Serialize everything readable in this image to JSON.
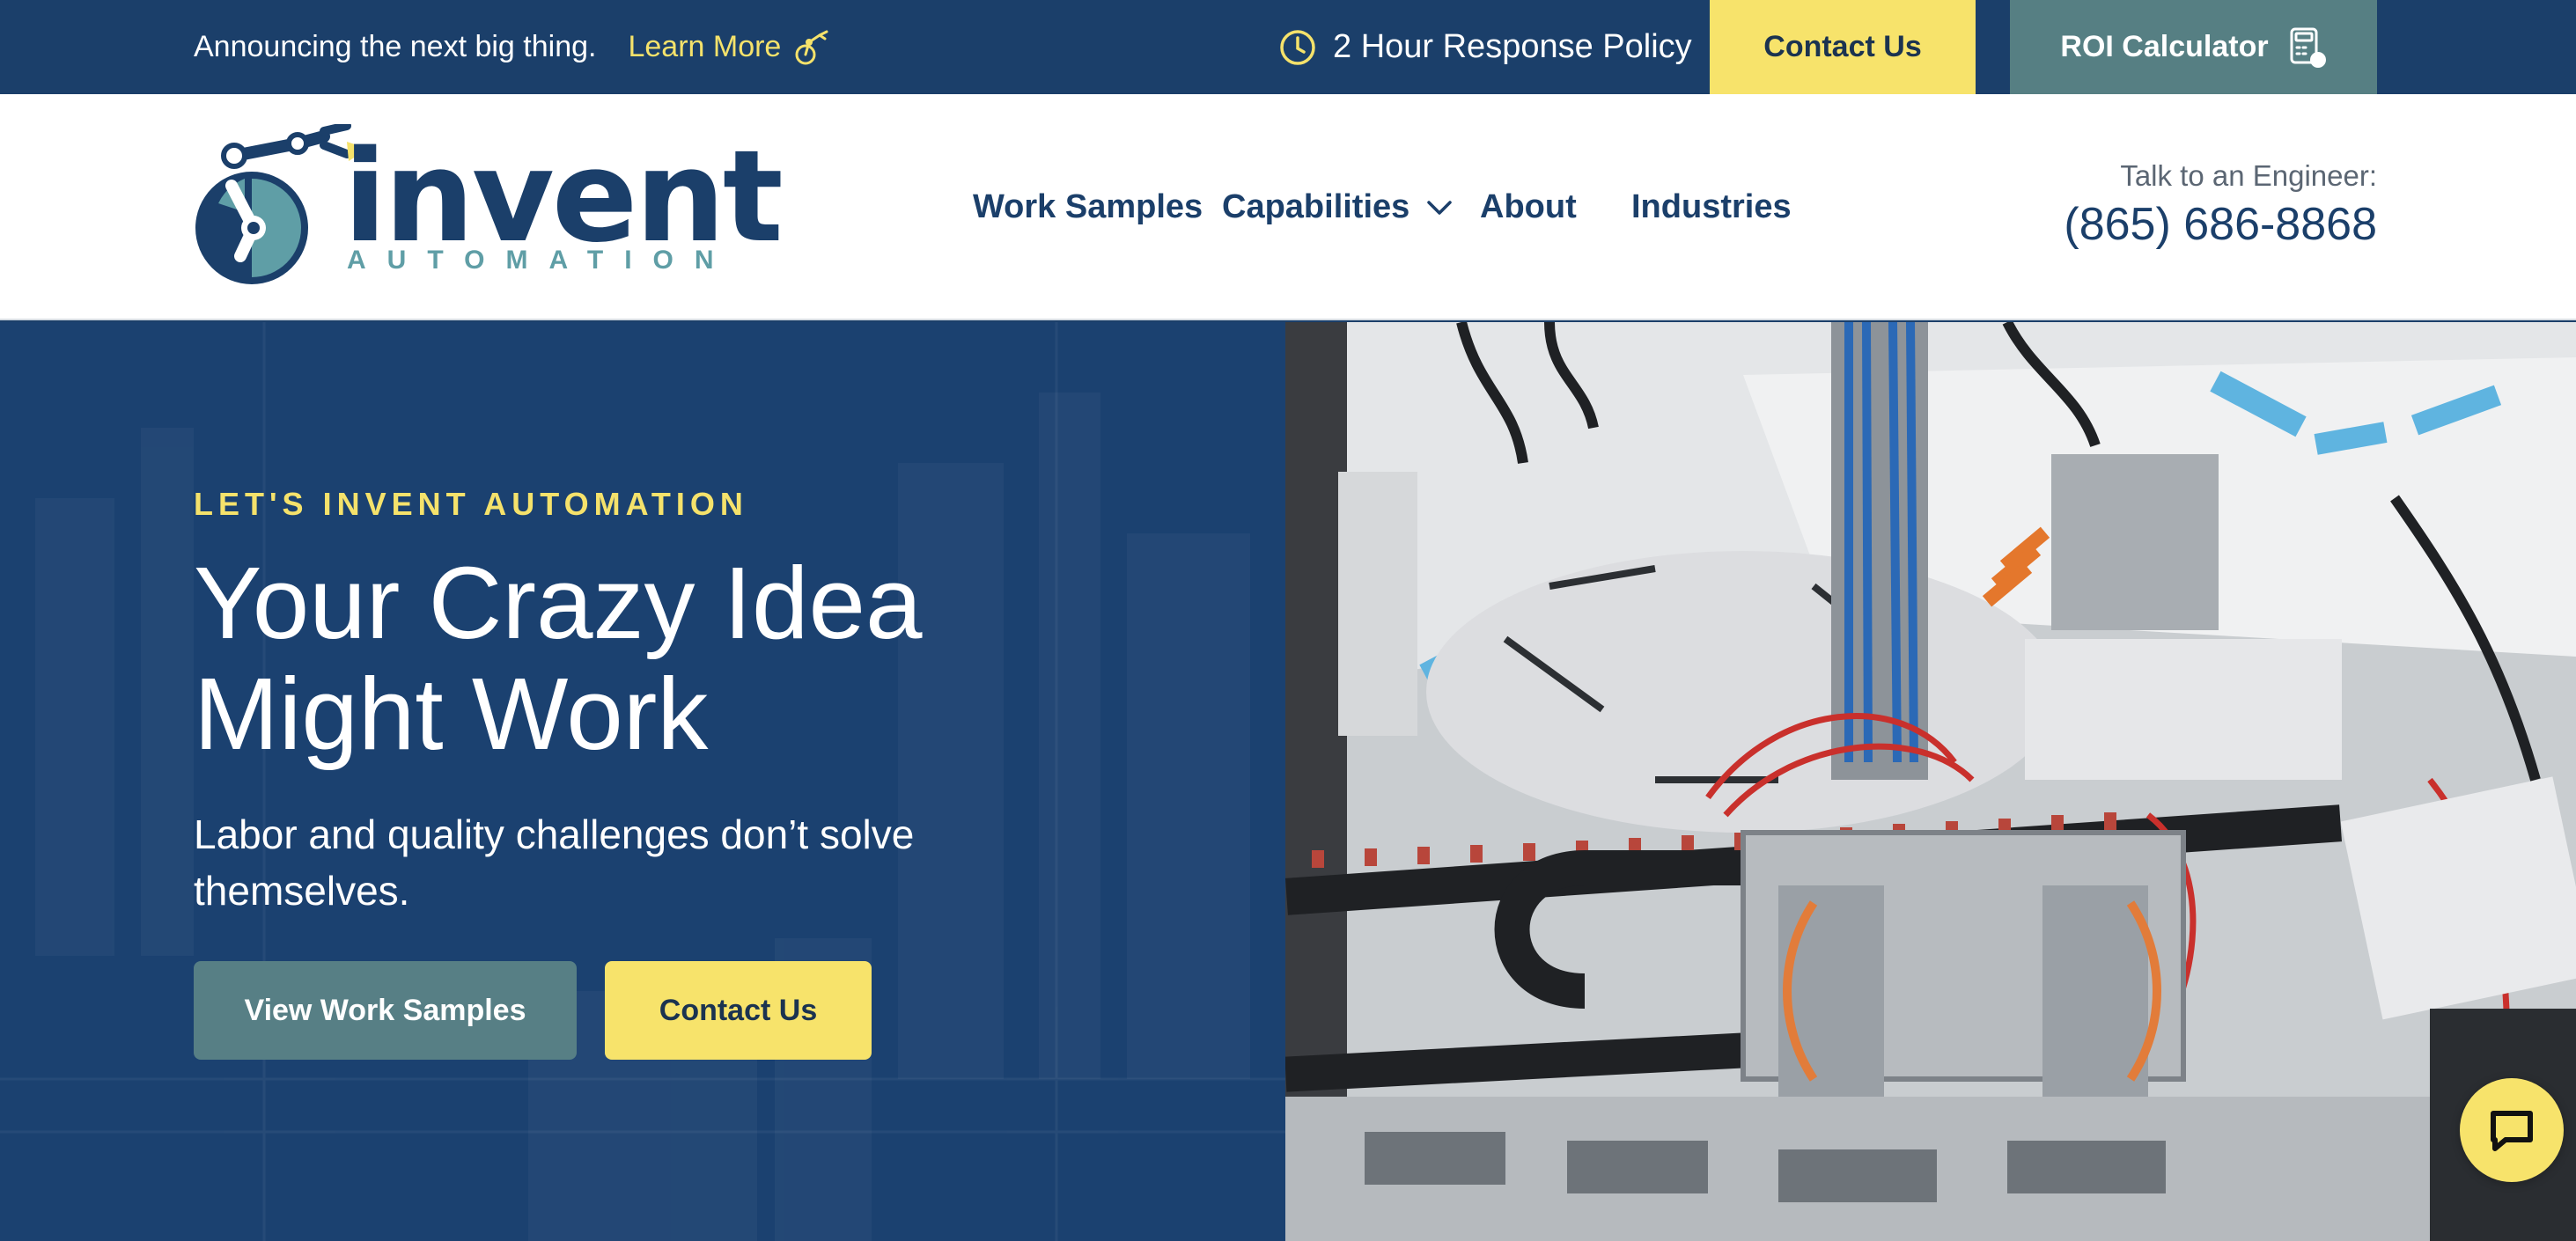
{
  "topbar": {
    "announcement": "Announcing the next big thing.",
    "learn_more": "Learn More",
    "response_policy": "2 Hour Response Policy",
    "contact_label": "Contact Us",
    "roi_label": "ROI Calculator"
  },
  "header": {
    "logo": {
      "word": "invent",
      "sub": "AUTOMATION"
    },
    "nav": {
      "work_samples": "Work Samples",
      "capabilities": "Capabilities",
      "about": "About",
      "industries": "Industries"
    },
    "engineer_label": "Talk to an Engineer:",
    "engineer_phone": "(865) 686-8868"
  },
  "hero": {
    "eyebrow": "LET'S INVENT AUTOMATION",
    "headline_line1": "Your Crazy Idea",
    "headline_line2": "Might Work",
    "subhead": "Labor and quality challenges don’t solve themselves.",
    "primary_button": "View Work Samples",
    "secondary_button": "Contact Us"
  },
  "colors": {
    "navy": "#1b3f6a",
    "yellow": "#f7e36b",
    "teal": "#567f83",
    "logo_teal": "#5f9ea6"
  },
  "icons": {
    "learn_more": "robot-arm-icon",
    "response": "clock-icon",
    "roi": "calculator-icon",
    "capabilities": "chevron-down-icon",
    "chat": "chat-bubble-icon"
  }
}
